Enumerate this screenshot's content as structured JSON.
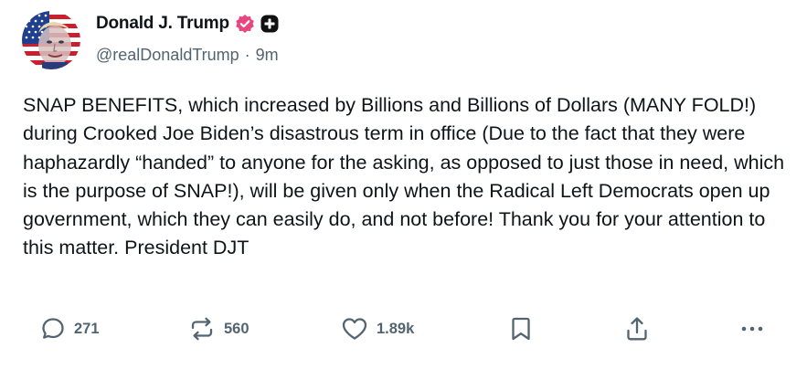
{
  "author": {
    "display_name": "Donald J. Trump",
    "handle": "@realDonaldTrump",
    "time": "9m",
    "separator": "·",
    "verified_badge_icon": "verified-check-icon",
    "verified_badge_color": "#e9467f",
    "plus_badge_icon": "plus-square-icon"
  },
  "post": {
    "text": "SNAP BENEFITS, which increased by Billions and Billions of Dollars (MANY FOLD!) during Crooked Joe Biden’s disastrous term in office (Due to the fact that they were haphazardly “handed” to anyone for the asking, as opposed to just those in need, which is the purpose of SNAP!), will be given only when the Radical Left Democrats open up government, which they can easily do, and not before! Thank you for your attention to this matter. President DJT"
  },
  "actions": {
    "reply": {
      "icon": "reply-bubble-icon",
      "count": "271"
    },
    "repost": {
      "icon": "repost-icon",
      "count": "560"
    },
    "like": {
      "icon": "heart-icon",
      "count": "1.89k"
    },
    "bookmark": {
      "icon": "bookmark-icon"
    },
    "share": {
      "icon": "share-upload-icon"
    },
    "more": {
      "icon": "more-dots-icon"
    }
  },
  "colors": {
    "text_primary": "#0f1419",
    "text_secondary": "#536471",
    "icon_gray": "#536471"
  }
}
